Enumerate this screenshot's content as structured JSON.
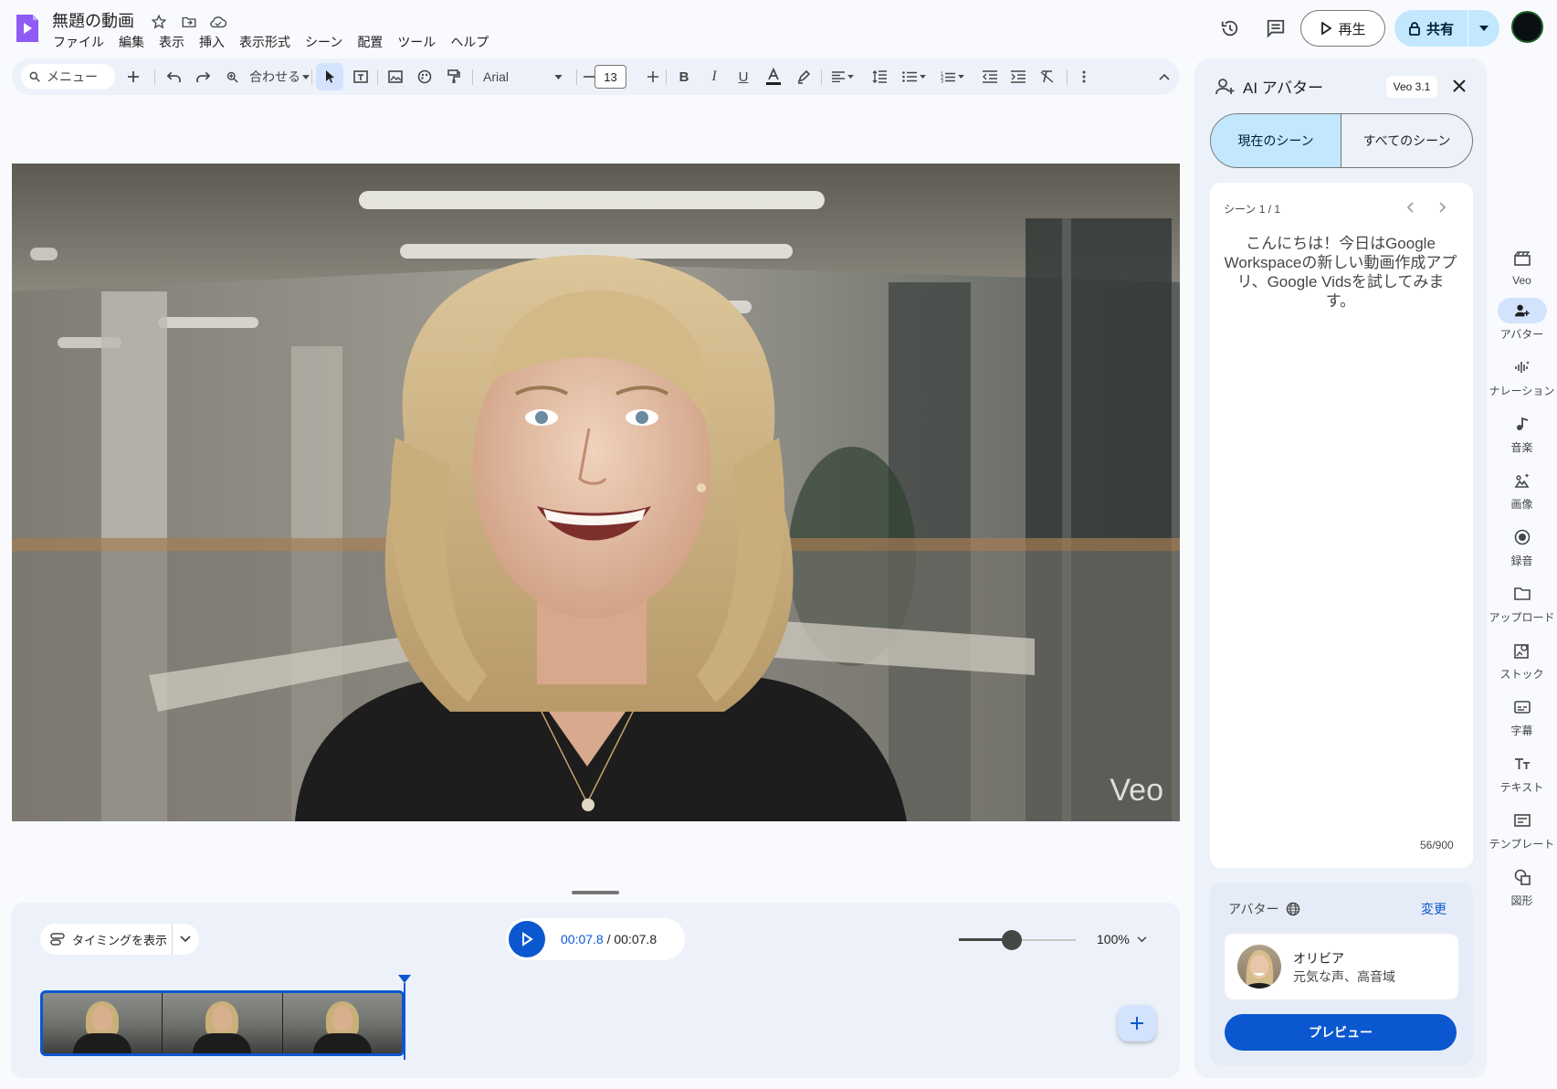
{
  "app": {
    "title": "無題の動画",
    "menu": [
      "ファイル",
      "編集",
      "表示",
      "挿入",
      "表示形式",
      "シーン",
      "配置",
      "ツール",
      "ヘルプ"
    ],
    "play_label": "再生",
    "share_label": "共有",
    "accent_color": "#0b57d0",
    "brand_color": "#7c4dff"
  },
  "toolbar": {
    "search_placeholder": "メニュー",
    "zoom_fit": "合わせる",
    "font": "Arial",
    "font_size": "13"
  },
  "canvas": {
    "watermark": "Veo"
  },
  "timeline": {
    "timing_label": "タイミングを表示",
    "current_time": "00:07.8",
    "separator": " / ",
    "total_time": "00:07.8",
    "zoom": "100%",
    "zoom_slider_fraction": 0.45,
    "clip_thumbnail_count": 3
  },
  "panel": {
    "title": "AI アバター",
    "badge": "Veo 3.1",
    "tab_current": "現在のシーン",
    "tab_all": "すべてのシーン",
    "scene_counter": "シーン 1 / 1",
    "script": "こんにちは！今日はGoogle Workspaceの新しい動画作成アプリ、Google Vidsを試してみます。",
    "char_count": "56/900",
    "avatar_section_label": "アバター",
    "change_label": "変更",
    "avatar_name": "オリビア",
    "avatar_desc": "元気な声、高音域",
    "preview_label": "プレビュー"
  },
  "rail": [
    {
      "label": "Veo",
      "icon": "veo-clapper-icon"
    },
    {
      "label": "アバター",
      "icon": "avatar-add-icon",
      "active": true
    },
    {
      "label": "ナレーション",
      "icon": "narration-icon"
    },
    {
      "label": "音楽",
      "icon": "music-icon"
    },
    {
      "label": "画像",
      "icon": "image-sparkle-icon"
    },
    {
      "label": "録音",
      "icon": "record-icon"
    },
    {
      "label": "アップロード",
      "icon": "folder-icon"
    },
    {
      "label": "ストック",
      "icon": "stock-icon"
    },
    {
      "label": "字幕",
      "icon": "captions-icon"
    },
    {
      "label": "テキスト",
      "icon": "text-icon"
    },
    {
      "label": "テンプレート",
      "icon": "template-icon"
    },
    {
      "label": "図形",
      "icon": "shapes-icon"
    }
  ]
}
